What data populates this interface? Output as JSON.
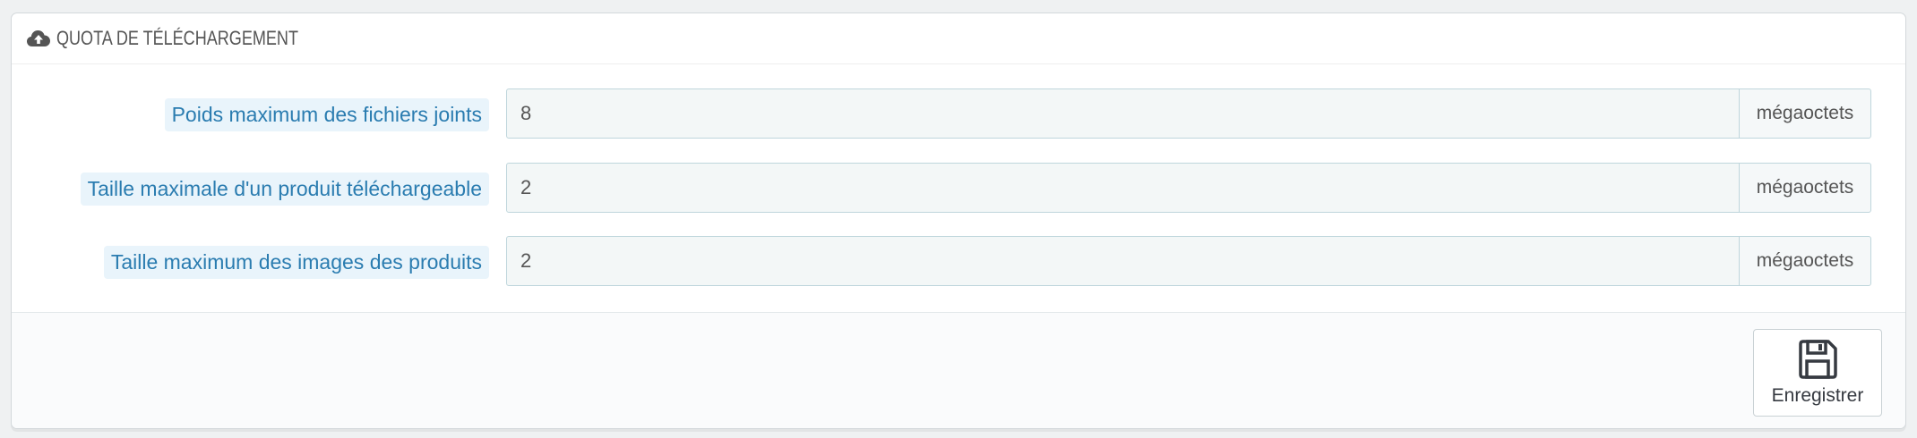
{
  "panel": {
    "title": "QUOTA DE TÉLÉCHARGEMENT",
    "title_icon": "cloud-upload-icon"
  },
  "fields": [
    {
      "label": "Poids maximum des fichiers joints",
      "value": "8",
      "unit": "mégaoctets"
    },
    {
      "label": "Taille maximale d'un produit téléchargeable",
      "value": "2",
      "unit": "mégaoctets"
    },
    {
      "label": "Taille maximum des images des produits",
      "value": "2",
      "unit": "mégaoctets"
    }
  ],
  "footer": {
    "save_label": "Enregistrer",
    "save_icon": "floppy-disk-icon"
  },
  "colors": {
    "label_text": "#2a7cb0",
    "label_bg": "#e9f4fb",
    "input_bg": "#f3f7f7",
    "input_border": "#bfd6dc"
  }
}
